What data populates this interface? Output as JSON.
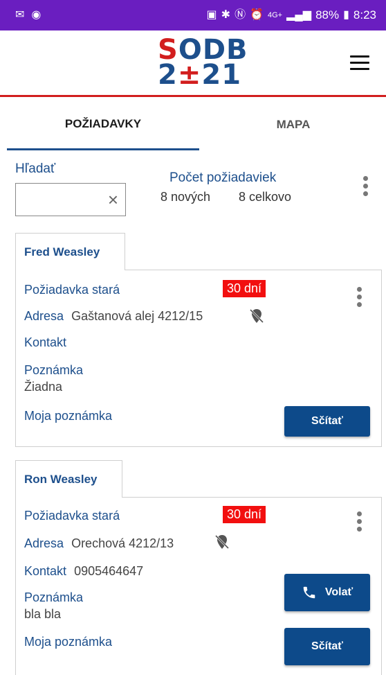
{
  "status_bar": {
    "left_icons": [
      "mail-icon",
      "account-icon"
    ],
    "network": "4G+",
    "battery": "88%",
    "time": "8:23"
  },
  "header": {
    "logo_line1_a": "S",
    "logo_line1_b": "ODB",
    "logo_line2_a": "2",
    "logo_line2_b": "±",
    "logo_line2_c": "21"
  },
  "tabs": [
    {
      "label": "POŽIADAVKY",
      "active": true
    },
    {
      "label": "MAPA",
      "active": false
    }
  ],
  "search": {
    "label": "Hľadať",
    "value": "",
    "placeholder": "",
    "clear_icon": "×"
  },
  "summary": {
    "title": "Počet požiadaviek",
    "new_count": "8 nových",
    "total_count": "8 celkovo"
  },
  "requests": [
    {
      "name": "Fred Weasley",
      "age_label": "Požiadavka stará",
      "age_badge": "30 dní",
      "address_label": "Adresa",
      "address_value": "Gaštanová alej 4212/15",
      "contact_label": "Kontakt",
      "contact_value": "",
      "note_label": "Poznámka",
      "note_value": "Žiadna",
      "my_note_label": "Moja poznámka",
      "count_button": "Sčítať"
    },
    {
      "name": "Ron Weasley",
      "age_label": "Požiadavka stará",
      "age_badge": "30 dní",
      "address_label": "Adresa",
      "address_value": "Orechová 4212/13",
      "contact_label": "Kontakt",
      "contact_value": "0905464647",
      "note_label": "Poznámka",
      "note_value": "bla bla",
      "my_note_label": "Moja poznámka",
      "call_button": "Volať",
      "count_button": "Sčítať"
    }
  ],
  "colors": {
    "status_bar": "#6a1ec0",
    "brand_blue": "#1d4f8c",
    "button_blue": "#0d4a8a",
    "accent_red": "#d21e1e",
    "badge_red": "#f20f0f"
  }
}
